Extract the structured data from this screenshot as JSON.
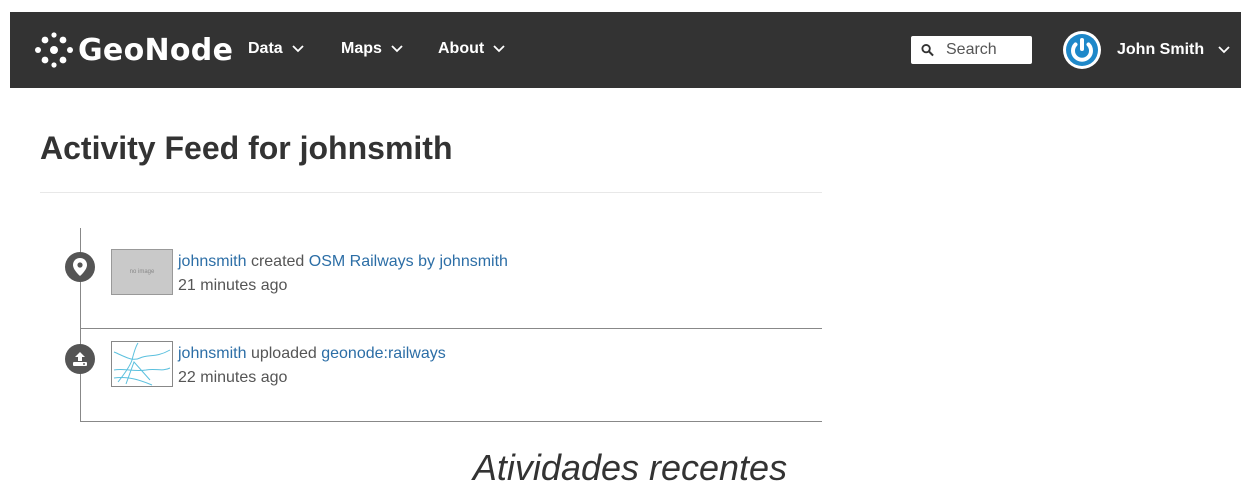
{
  "navbar": {
    "brand": "GeoNode",
    "menu": [
      {
        "label": "Data"
      },
      {
        "label": "Maps"
      },
      {
        "label": "About"
      }
    ],
    "search": {
      "placeholder": "Search"
    },
    "user": {
      "name": "John Smith"
    }
  },
  "main": {
    "title": "Activity Feed for johnsmith",
    "activities": [
      {
        "actor": "johnsmith",
        "verb": "created",
        "target": "OSM Railways by johnsmith",
        "time": "21 minutes ago",
        "icon": "map-marker-icon",
        "thumbnail_text": "no image"
      },
      {
        "actor": "johnsmith",
        "verb": "uploaded",
        "target": "geonode:railways",
        "time": "22 minutes ago",
        "icon": "upload-icon"
      }
    ]
  },
  "caption": "Atividades recentes",
  "colors": {
    "navbar_bg": "#333333",
    "link": "#2c6ea6",
    "avatar": "#1e88c9",
    "timeline_icon": "#555555"
  }
}
